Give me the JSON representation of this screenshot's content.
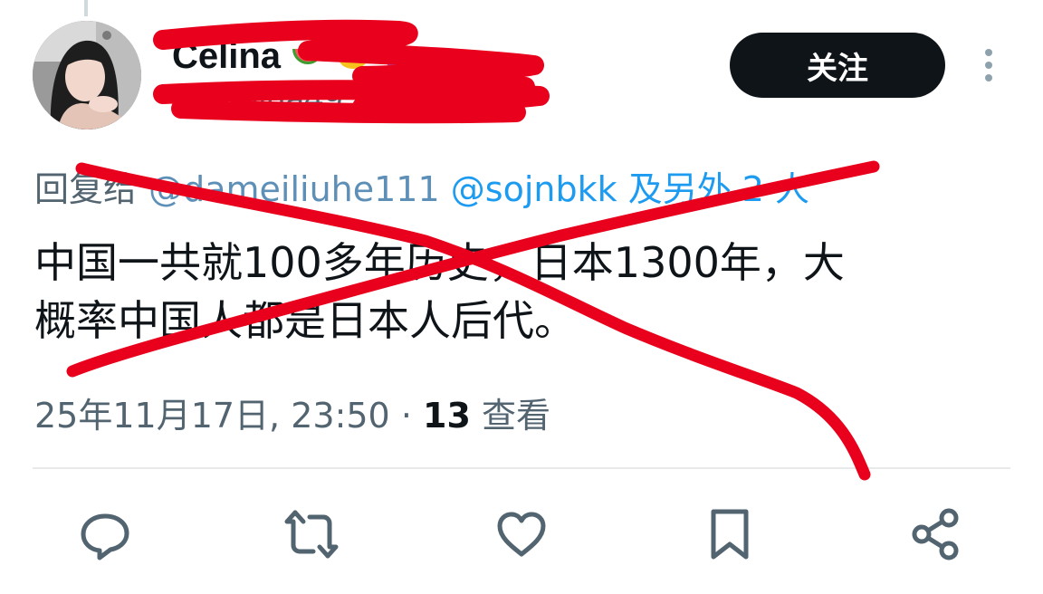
{
  "tweet": {
    "display_name": "Celina",
    "handle": "@Celina49307255",
    "follow_label": "关注",
    "reply_prefix": "回复给",
    "reply_mentions": [
      "@dameiliuhe111",
      "@sojnbkk"
    ],
    "reply_others": "及另外 2 人",
    "text": "中国一共就100多年历史，日本1300年，大\n概率中国人都是日本人后代。",
    "timestamp": "25年11月17日, 23:50",
    "separator": "·",
    "view_count": "13",
    "view_label": "查看"
  },
  "icons": {
    "name_emojis": [
      "watermelon-icon",
      "lemon-icon",
      "grapes-icon"
    ],
    "more": "more-vertical-icon",
    "actions": [
      "reply-icon",
      "retweet-icon",
      "like-icon",
      "bookmark-icon",
      "share-icon"
    ]
  },
  "colors": {
    "text_primary": "#0f1419",
    "text_secondary": "#536471",
    "link": "#1d9bf0",
    "follow_bg": "#0f1419",
    "annotation_red": "#e8001c"
  }
}
